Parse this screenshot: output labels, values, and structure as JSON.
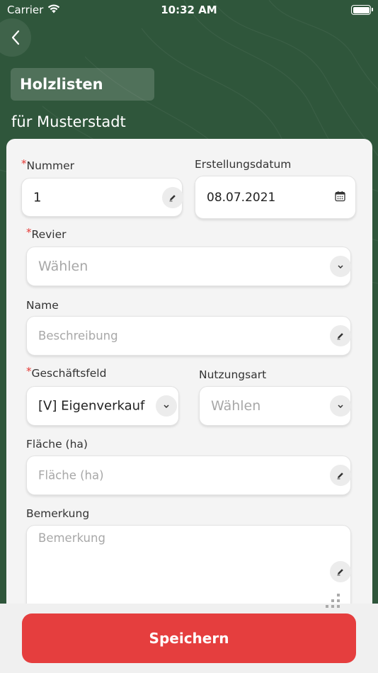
{
  "status_bar": {
    "carrier": "Carrier",
    "time": "10:32 AM"
  },
  "header": {
    "title": "Holzlisten",
    "subtitle": "für Musterstadt"
  },
  "form": {
    "nummer": {
      "label": "Nummer",
      "required": "*",
      "value": "1"
    },
    "erstellungsdatum": {
      "label": "Erstellungsdatum",
      "value": "08.07.2021"
    },
    "revier": {
      "label": "Revier",
      "required": "*",
      "placeholder": "Wählen"
    },
    "name": {
      "label": "Name",
      "placeholder": "Beschreibung"
    },
    "geschaeftsfeld": {
      "label": "Geschäftsfeld",
      "required": "*",
      "value": "[V] Eigenverkauf"
    },
    "nutzungsart": {
      "label": "Nutzungsart",
      "placeholder": "Wählen"
    },
    "flaeche": {
      "label": "Fläche (ha)",
      "placeholder": "Fläche (ha)"
    },
    "bemerkung": {
      "label": "Bemerkung",
      "placeholder": "Bemerkung"
    }
  },
  "actions": {
    "save_label": "Speichern"
  },
  "colors": {
    "background": "#2f563b",
    "accent": "#e53e3e",
    "required": "#e53935"
  },
  "icons": {
    "back": "chevron-left-icon",
    "edit": "pencil-icon",
    "calendar": "calendar-icon",
    "dropdown": "chevron-down-icon"
  }
}
